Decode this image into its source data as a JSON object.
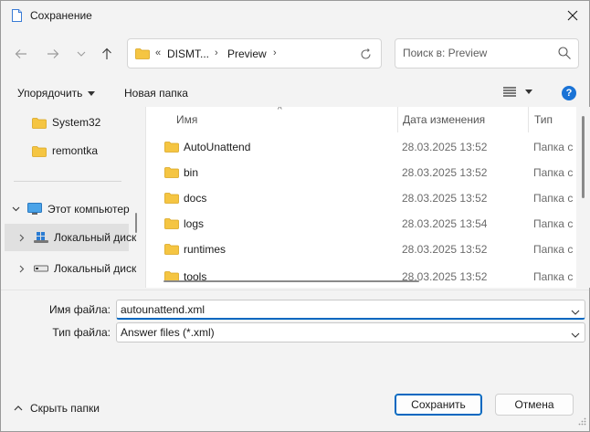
{
  "window": {
    "title": "Сохранение"
  },
  "address": {
    "overflow": "«",
    "crumbs": [
      "DISMT...",
      "Preview"
    ]
  },
  "search": {
    "placeholder": "Поиск в: Preview"
  },
  "toolbar": {
    "organize_label": "Упорядочить",
    "new_folder_label": "Новая папка",
    "help_label": "?"
  },
  "nav": {
    "items": [
      {
        "label": "System32",
        "icon": "folder-icon"
      },
      {
        "label": "remontka",
        "icon": "folder-icon"
      },
      {
        "label": "Этот компьютер",
        "icon": "computer-icon"
      },
      {
        "label": "Локальный диск",
        "icon": "drive-icon"
      },
      {
        "label": "Локальный диск",
        "icon": "drive-icon"
      }
    ]
  },
  "columns": {
    "name": "Имя",
    "date": "Дата изменения",
    "type": "Тип"
  },
  "files": [
    {
      "name": "AutoUnattend",
      "date": "28.03.2025 13:52",
      "type": "Папка с"
    },
    {
      "name": "bin",
      "date": "28.03.2025 13:52",
      "type": "Папка с"
    },
    {
      "name": "docs",
      "date": "28.03.2025 13:52",
      "type": "Папка с"
    },
    {
      "name": "logs",
      "date": "28.03.2025 13:54",
      "type": "Папка с"
    },
    {
      "name": "runtimes",
      "date": "28.03.2025 13:52",
      "type": "Папка с"
    },
    {
      "name": "tools",
      "date": "28.03.2025 13:52",
      "type": "Папка с"
    }
  ],
  "form": {
    "filename_label": "Имя файла:",
    "filename_value": "autounattend.xml",
    "filetype_label": "Тип файла:",
    "filetype_value": "Answer files (*.xml)"
  },
  "footer": {
    "hide_folders_label": "Скрыть папки",
    "save_label": "Сохранить",
    "cancel_label": "Отмена"
  },
  "colors": {
    "accent": "#0067c0",
    "folder": "#f5c542",
    "help": "#1a73d6"
  }
}
